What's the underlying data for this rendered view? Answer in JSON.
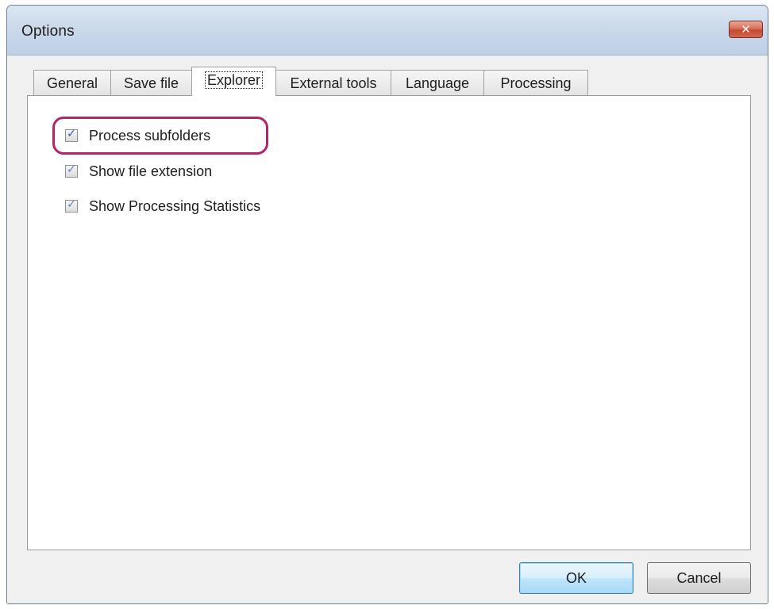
{
  "window": {
    "title": "Options",
    "close_glyph": "✕"
  },
  "tabs": [
    {
      "label": "General",
      "active": false
    },
    {
      "label": "Save file",
      "active": false
    },
    {
      "label": "Explorer",
      "active": true
    },
    {
      "label": "External tools",
      "active": false
    },
    {
      "label": "Language",
      "active": false
    },
    {
      "label": "Processing",
      "active": false
    }
  ],
  "explorer": {
    "options": [
      {
        "label": "Process subfolders",
        "checked": true,
        "highlighted": true
      },
      {
        "label": "Show file extension",
        "checked": true,
        "highlighted": false
      },
      {
        "label": "Show Processing Statistics",
        "checked": true,
        "highlighted": false
      }
    ],
    "check_glyph": "✓"
  },
  "buttons": {
    "ok_label": "OK",
    "cancel_label": "Cancel"
  },
  "colors": {
    "highlight_ring": "#b3246a",
    "close_button": "#c44a32",
    "check_mark": "#2c5aa8"
  }
}
